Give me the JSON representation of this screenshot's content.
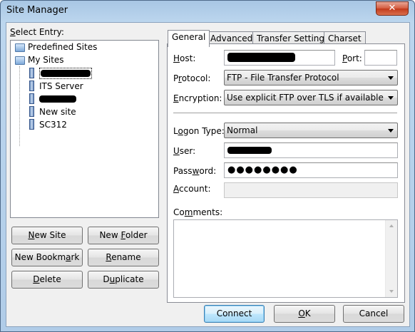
{
  "window": {
    "title": "Site Manager",
    "close_glyph": "✕"
  },
  "left": {
    "select_label": "Select Entry:",
    "tree": {
      "predefined": "Predefined Sites",
      "my_sites": "My Sites",
      "items": [
        "ITS Server",
        "New site",
        "SC312"
      ]
    },
    "buttons": {
      "new_site": "New Site",
      "new_folder": "New Folder",
      "new_bookmark": "New Bookmark",
      "rename": "Rename",
      "delete": "Delete",
      "duplicate": "Duplicate"
    }
  },
  "tabs": [
    "General",
    "Advanced",
    "Transfer Settings",
    "Charset"
  ],
  "general": {
    "host_label": "Host:",
    "port_label": "Port:",
    "port_value": "",
    "protocol_label": "Protocol:",
    "protocol_value": "FTP - File Transfer Protocol",
    "encryption_label": "Encryption:",
    "encryption_value": "Use explicit FTP over TLS if available",
    "logon_type_label": "Logon Type:",
    "logon_type_value": "Normal",
    "user_label": "User:",
    "password_label": "Password:",
    "password_value": "●●●●●●●●",
    "account_label": "Account:",
    "comments_label": "Comments:"
  },
  "footer": {
    "connect": "Connect",
    "ok": "OK",
    "cancel": "Cancel"
  }
}
